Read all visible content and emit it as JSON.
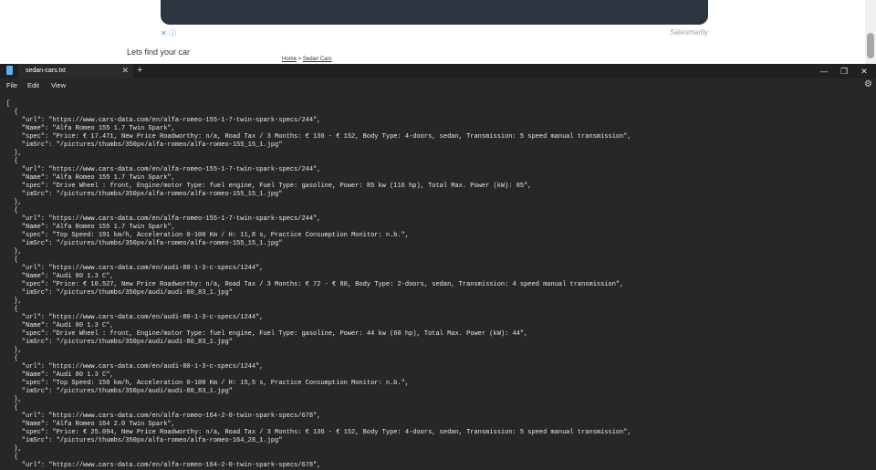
{
  "webpage": {
    "ad_close": "✕ ⓘ",
    "ad_brand": "Salesmartly",
    "heading": "Lets find your car",
    "breadcrumb": {
      "home": "Home",
      "sep": ">",
      "current": "Sedan Cars"
    }
  },
  "notepad": {
    "tab_title": "sedan-cars.txt",
    "tab_close": "✕",
    "new_tab": "+",
    "win_min": "—",
    "win_max": "❐",
    "win_close": "✕",
    "menu": [
      "File",
      "Edit",
      "View"
    ],
    "settings_icon": "⚙",
    "lines": [
      "[",
      "  {",
      "    \"url\": \"https://www.cars-data.com/en/alfa-romeo-155-1-7-twin-spark-specs/244\",",
      "    \"Name\": \"Alfa Romeo 155 1.7 Twin Spark\",",
      "    \"spec\": \"Price: € 17.471, New Price Roadworthy: n/a, Road Tax / 3 Months: € 136 - € 152, Body Type: 4-doors, sedan, Transmission: 5 speed manual transmission\",",
      "    \"imSrc\": \"/pictures/thumbs/350px/alfa-romeo/alfa-romeo-155_15_1.jpg\"",
      "  },",
      "  {",
      "    \"url\": \"https://www.cars-data.com/en/alfa-romeo-155-1-7-twin-spark-specs/244\",",
      "    \"Name\": \"Alfa Romeo 155 1.7 Twin Spark\",",
      "    \"spec\": \"Drive Wheel : front, Engine/motor Type: fuel engine, Fuel Type: gasoline, Power: 85 kw (116 hp), Total Max. Power (kW): 85\",",
      "    \"imSrc\": \"/pictures/thumbs/350px/alfa-romeo/alfa-romeo-155_15_1.jpg\"",
      "  },",
      "  {",
      "    \"url\": \"https://www.cars-data.com/en/alfa-romeo-155-1-7-twin-spark-specs/244\",",
      "    \"Name\": \"Alfa Romeo 155 1.7 Twin Spark\",",
      "    \"spec\": \"Top Speed: 191 km/h, Acceleration 0-100 Km / H: 11,8 s, Practice Consumption Monitor: n.b.\",",
      "    \"imSrc\": \"/pictures/thumbs/350px/alfa-romeo/alfa-romeo-155_15_1.jpg\"",
      "  },",
      "  {",
      "    \"url\": \"https://www.cars-data.com/en/audi-80-1-3-c-specs/1244\",",
      "    \"Name\": \"Audi 80 1.3 C\",",
      "    \"spec\": \"Price: € 10.527, New Price Roadworthy: n/a, Road Tax / 3 Months: € 72 - € 80, Body Type: 2-doors, sedan, Transmission: 4 speed manual transmission\",",
      "    \"imSrc\": \"/pictures/thumbs/350px/audi/audi-80_83_1.jpg\"",
      "  },",
      "  {",
      "    \"url\": \"https://www.cars-data.com/en/audi-80-1-3-c-specs/1244\",",
      "    \"Name\": \"Audi 80 1.3 C\",",
      "    \"spec\": \"Drive Wheel : front, Engine/motor Type: fuel engine, Fuel Type: gasoline, Power: 44 kw (60 hp), Total Max. Power (kW): 44\",",
      "    \"imSrc\": \"/pictures/thumbs/350px/audi/audi-80_83_1.jpg\"",
      "  },",
      "  {",
      "    \"url\": \"https://www.cars-data.com/en/audi-80-1-3-c-specs/1244\",",
      "    \"Name\": \"Audi 80 1.3 C\",",
      "    \"spec\": \"Top Speed: 150 km/h, Acceleration 0-100 Km / H: 15,5 s, Practice Consumption Monitor: n.b.\",",
      "    \"imSrc\": \"/pictures/thumbs/350px/audi/audi-80_83_1.jpg\"",
      "  },",
      "  {",
      "    \"url\": \"https://www.cars-data.com/en/alfa-romeo-164-2-0-twin-spark-specs/678\",",
      "    \"Name\": \"Alfa Romeo 164 2.0 Twin Spark\",",
      "    \"spec\": \"Price: € 25.094, New Price Roadworthy: n/a, Road Tax / 3 Months: € 136 - € 152, Body Type: 4-doors, sedan, Transmission: 5 speed manual transmission\",",
      "    \"imSrc\": \"/pictures/thumbs/350px/alfa-romeo/alfa-romeo-164_28_1.jpg\"",
      "  },",
      "  {",
      "    \"url\": \"https://www.cars-data.com/en/alfa-romeo-164-2-0-twin-spark-specs/678\","
    ]
  }
}
